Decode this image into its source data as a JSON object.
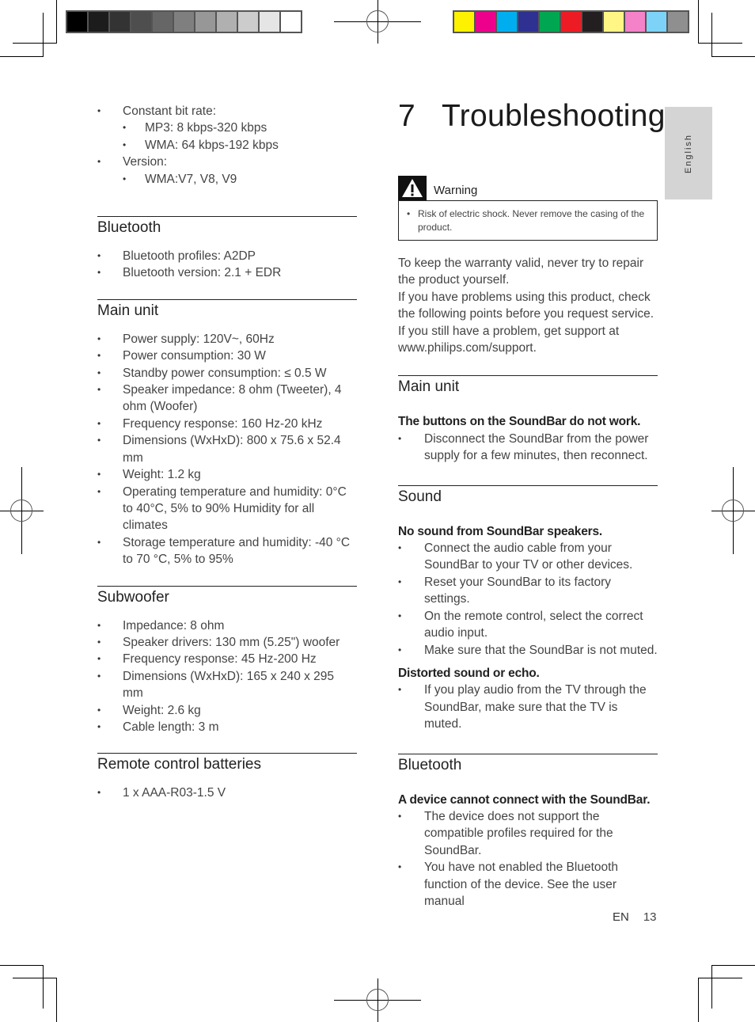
{
  "color_bars": {
    "grayscale": [
      "#000000",
      "#1c1c1c",
      "#333333",
      "#4e4e4e",
      "#666666",
      "#7f7f7f",
      "#979797",
      "#b0b0b0",
      "#cccccc",
      "#e5e5e5",
      "#ffffff"
    ],
    "process": [
      "#fff200",
      "#ec008c",
      "#00aeef",
      "#2e3192",
      "#00a651",
      "#ed1c24",
      "#231f20",
      "#fff685",
      "#f482c8",
      "#7dd3f7",
      "#8f8f8f"
    ]
  },
  "language_tab": "English",
  "left_column": {
    "intro_list": [
      {
        "text": "Constant bit rate:",
        "sub": [
          "MP3: 8 kbps-320 kbps",
          "WMA: 64 kbps-192 kbps"
        ]
      },
      {
        "text": "Version:",
        "sub": [
          "WMA:V7, V8, V9"
        ]
      }
    ],
    "sections": [
      {
        "title": "Bluetooth",
        "items": [
          "Bluetooth profiles: A2DP",
          "Bluetooth version: 2.1 + EDR"
        ]
      },
      {
        "title": "Main unit",
        "items": [
          "Power supply: 120V~, 60Hz",
          "Power consumption: 30 W",
          "Standby power consumption: ≤ 0.5 W",
          "Speaker impedance: 8 ohm (Tweeter), 4 ohm (Woofer)",
          "Frequency response: 160 Hz-20 kHz",
          "Dimensions (WxHxD): 800 x 75.6 x 52.4 mm",
          "Weight: 1.2 kg",
          "Operating temperature and humidity: 0°C to 40°C, 5% to 90% Humidity for all climates",
          "Storage temperature and humidity: -40 °C to 70 °C, 5% to 95%"
        ]
      },
      {
        "title": "Subwoofer",
        "items": [
          "Impedance: 8 ohm",
          "Speaker drivers: 130 mm (5.25\") woofer",
          "Frequency response: 45 Hz-200 Hz",
          "Dimensions (WxHxD): 165 x 240 x 295 mm",
          "Weight: 2.6 kg",
          "Cable length: 3 m"
        ]
      },
      {
        "title": "Remote control batteries",
        "items": [
          "1 x AAA-R03-1.5 V"
        ]
      }
    ]
  },
  "right_column": {
    "chapter_number": "7",
    "chapter_title": "Troubleshooting",
    "warning": {
      "label": "Warning",
      "items": [
        "Risk of electric shock. Never remove the casing of the product."
      ]
    },
    "intro": [
      "To keep the warranty valid, never try to repair the product yourself.",
      "If you have problems using this product, check the following points before you request service. If you still have a problem, get support at www.philips.com/support."
    ],
    "sections": [
      {
        "title": "Main unit",
        "problems": [
          {
            "question": "The buttons on the SoundBar do not work.",
            "answers": [
              "Disconnect the SoundBar from the power supply for a few minutes, then reconnect."
            ]
          }
        ]
      },
      {
        "title": "Sound",
        "problems": [
          {
            "question": "No sound from SoundBar speakers.",
            "answers": [
              "Connect the audio cable from your SoundBar to your TV or other devices.",
              "Reset your SoundBar to its factory settings.",
              "On the remote control, select the correct audio input.",
              "Make sure that the SoundBar is not muted."
            ]
          },
          {
            "question": "Distorted sound or echo.",
            "answers": [
              "If you play audio from the TV through the SoundBar, make sure that the TV is muted."
            ]
          }
        ]
      },
      {
        "title": "Bluetooth",
        "problems": [
          {
            "question": "A device cannot connect with the SoundBar.",
            "answers": [
              "The device does not support the compatible profiles required for the SoundBar.",
              "You have not enabled the Bluetooth function of the device. See the user manual"
            ]
          }
        ]
      }
    ]
  },
  "footer": {
    "lang": "EN",
    "page": "13"
  }
}
